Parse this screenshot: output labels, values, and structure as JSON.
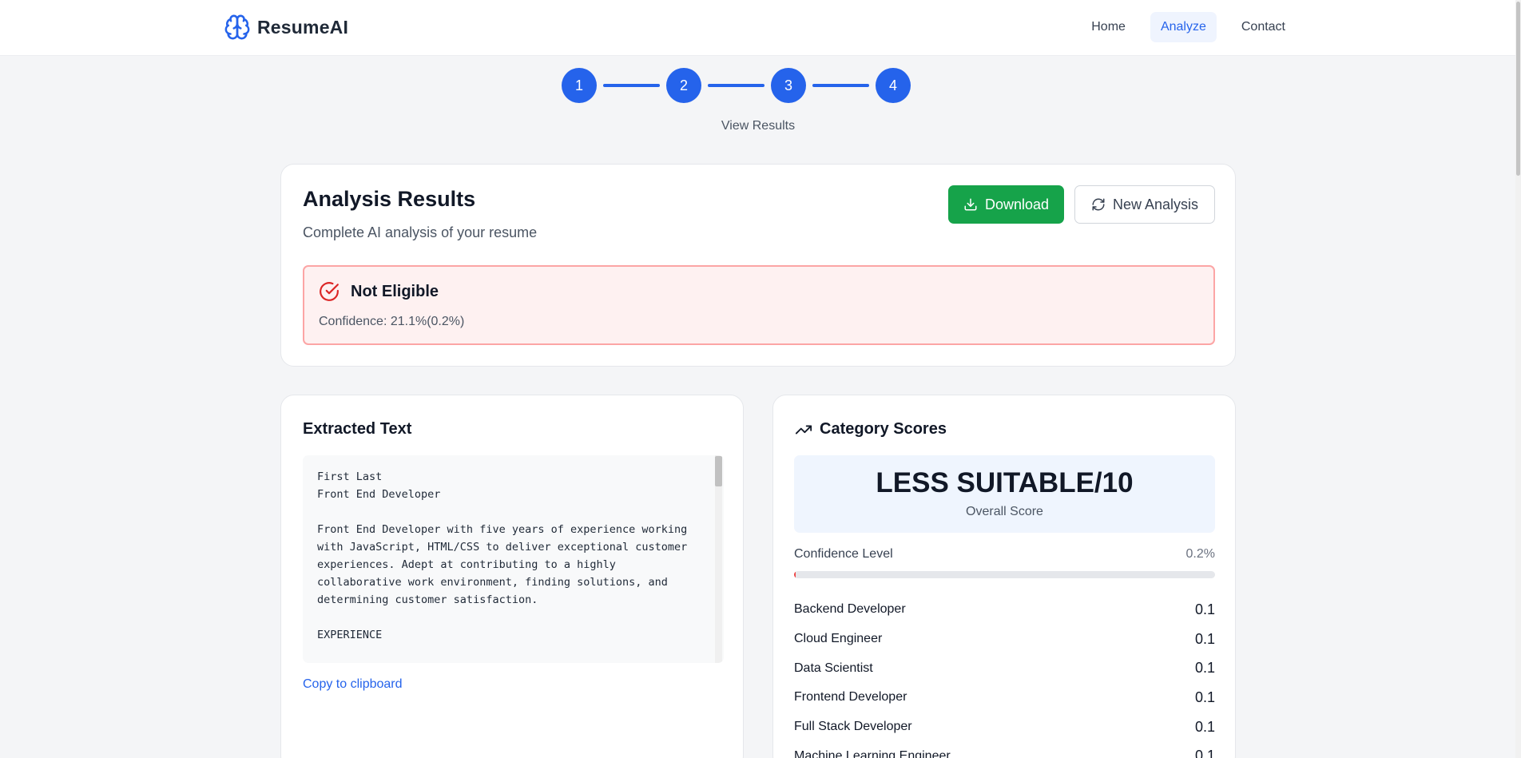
{
  "header": {
    "brand": "ResumeAI",
    "nav": [
      {
        "label": "Home",
        "active": false
      },
      {
        "label": "Analyze",
        "active": true
      },
      {
        "label": "Contact",
        "active": false
      }
    ]
  },
  "stepper": {
    "steps": [
      "1",
      "2",
      "3",
      "4"
    ],
    "caption": "View Results"
  },
  "results": {
    "title": "Analysis Results",
    "subtitle": "Complete AI analysis of your resume",
    "download_label": "Download",
    "new_analysis_label": "New Analysis",
    "status": {
      "title": "Not Eligible",
      "confidence": "Confidence: 21.1%(0.2%)"
    }
  },
  "extracted": {
    "title": "Extracted Text",
    "text": "First Last\nFront End Developer\n\nFront End Developer with five years of experience working\nwith JavaScript, HTML/CSS to deliver exceptional customer\nexperiences. Adept at contributing to a highly\ncollaborative work environment, finding solutions, and\ndetermining customer satisfaction.\n\nEXPERIENCE",
    "copy_label": "Copy to clipboard"
  },
  "scores": {
    "title": "Category Scores",
    "overall_value": "LESS SUITABLE/10",
    "overall_label": "Overall Score",
    "confidence_label": "Confidence Level",
    "confidence_value": "0.2%",
    "confidence_fraction": 0.002,
    "categories": [
      {
        "name": "Backend Developer",
        "score": "0.1"
      },
      {
        "name": "Cloud Engineer",
        "score": "0.1"
      },
      {
        "name": "Data Scientist",
        "score": "0.1"
      },
      {
        "name": "Frontend Developer",
        "score": "0.1"
      },
      {
        "name": "Full Stack Developer",
        "score": "0.1"
      },
      {
        "name": "Machine Learning Engineer",
        "score": "0.1"
      }
    ]
  },
  "colors": {
    "primary": "#2563eb",
    "success": "#16a34a",
    "danger": "#ef4444",
    "danger_bg": "#fef1f1"
  }
}
